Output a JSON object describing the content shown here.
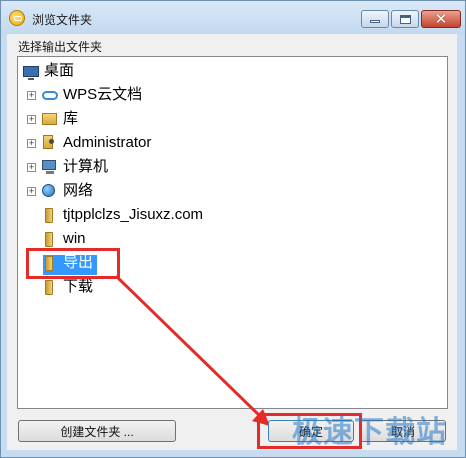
{
  "window": {
    "title": "浏览文件夹"
  },
  "dialog": {
    "instruction": "选择输出文件夹"
  },
  "tree": {
    "items": [
      {
        "label": "桌面",
        "icon": "desktop-icon"
      },
      {
        "label": "WPS云文档",
        "icon": "cloud-icon"
      },
      {
        "label": "库",
        "icon": "library-icon"
      },
      {
        "label": "Administrator",
        "icon": "user-folder-icon"
      },
      {
        "label": "计算机",
        "icon": "computer-icon"
      },
      {
        "label": "网络",
        "icon": "network-icon"
      },
      {
        "label": "tjtpplclzs_Jisuxz.com",
        "icon": "folder-icon"
      },
      {
        "label": "win",
        "icon": "folder-icon"
      },
      {
        "label": "导出",
        "icon": "folder-icon",
        "selected": true
      },
      {
        "label": "下载",
        "icon": "folder-icon"
      }
    ]
  },
  "buttons": {
    "new_folder": "创建文件夹 ...",
    "ok": "确定",
    "cancel": "取消"
  },
  "watermark": {
    "text": "极速下载站"
  },
  "colors": {
    "selection": "#3399ff",
    "annotation": "#e52a2a"
  }
}
